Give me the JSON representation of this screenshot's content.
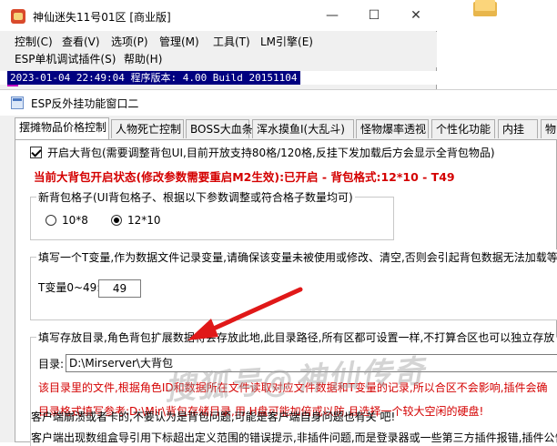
{
  "main_window": {
    "title": "神仙迷失11号01区 [商业版]",
    "controls": {
      "minimize": "—",
      "maximize": "☐",
      "close": "✕"
    },
    "menu_row1": [
      "控制(C)",
      "查看(V)",
      "选项(P)",
      "管理(M)",
      "工具(T)",
      "LM引擎(E)"
    ],
    "menu_row2": [
      "ESP单机调试插件(S)",
      "帮助(H)"
    ],
    "log_line": "2023-01-04 22:49:04 程序版本: 4.00 Build 20151104"
  },
  "dialog": {
    "title": "ESP反外挂功能窗口二",
    "tabs": [
      "摆摊物品价格控制",
      "人物死亡控制",
      "BOSS大血条",
      "浑水摸鱼I(大乱斗)",
      "怪物爆率透视",
      "个性化功能",
      "内挂",
      "物"
    ],
    "active_tab_index": 0,
    "panel": {
      "big_bag_checkbox_label": "开启大背包(需要调整背包UI,目前开放支持80格/120格,反挂下发加载后方会显示全背包物品)",
      "big_bag_checked": true,
      "status_line": "当前大背包开启状态(修改参数需要重启M2生效):已开启 - 背包格式:12*10 - T49",
      "grid_group": {
        "label": "新背包格子(UI背包格子、根据以下参数调整或符合格子数量均可)",
        "options": [
          "10*8",
          "12*10"
        ],
        "selected": "12*10"
      },
      "tvar_group": {
        "label": "填写一个T变量,作为数据文件记录变量,请确保该变量未被使用或修改、清空,否则会引起背包数据无法加载等",
        "field_label": "T变量0~49:",
        "field_value": "49"
      },
      "dir_group": {
        "label": "填写存放目录,角色背包扩展数据将会存放此地,此目录路径,所有区都可设置一样,不打算合区也可以独立存放",
        "field_label": "目录:",
        "field_value": "D:\\Mirserver\\大背包",
        "note1": "该目录里的文件,根据角色ID和数据所在文件读取对应文件数据和T变量的记录,所以合区不会影响,插件会确",
        "note2": "目录格式填写参考:D:\\Mir\\背包存储目录,用 H盘可能加倍或以防,且选择一个较大空闲的硬盘!"
      },
      "bottom_line1": "客户端崩溃或者卡的,不要认为是背包问题,可能是客户端自身问题也有关 吧!",
      "bottom_line2": "客户端出现数组盒导引用下标超出定义范围的错误提示,非插件问题,而是登录器或一些第三方插件报错,插件公告"
    }
  },
  "watermark_text": "搜狐号@神仙传奇"
}
